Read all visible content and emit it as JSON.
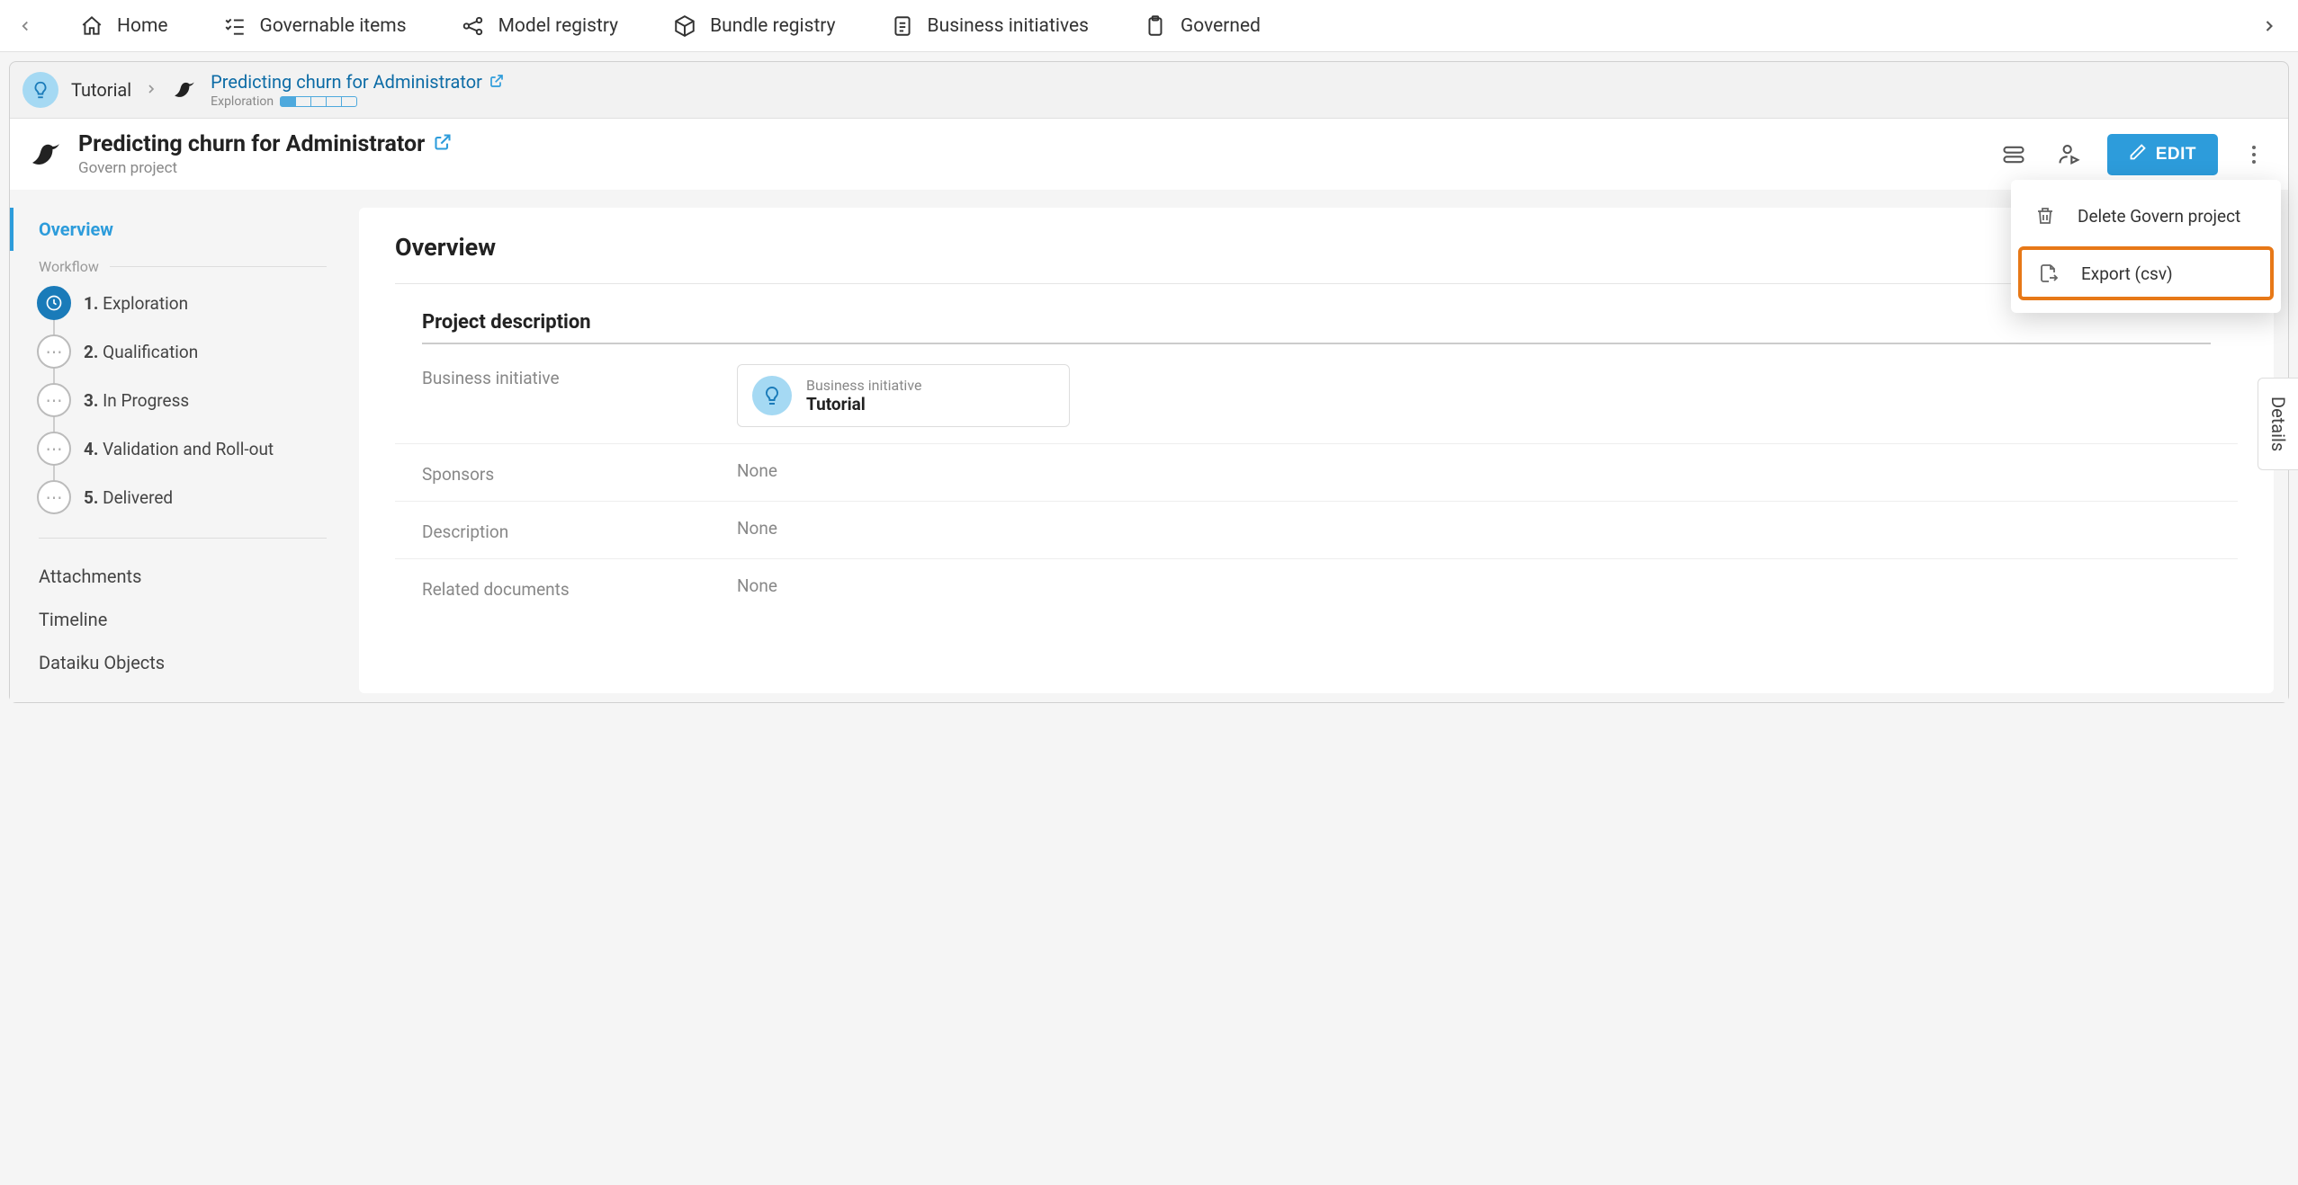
{
  "topnav": {
    "items": [
      {
        "label": "Home"
      },
      {
        "label": "Governable items"
      },
      {
        "label": "Model registry"
      },
      {
        "label": "Bundle registry"
      },
      {
        "label": "Business initiatives"
      },
      {
        "label": "Governed"
      }
    ]
  },
  "breadcrumb": {
    "tutorial": "Tutorial",
    "project_title": "Predicting churn for Administrator",
    "stage": "Exploration"
  },
  "titlebar": {
    "title": "Predicting churn for Administrator",
    "subtitle": "Govern project",
    "edit_label": "EDIT"
  },
  "dropdown": {
    "delete": "Delete Govern project",
    "export": "Export (csv)"
  },
  "sidebar": {
    "overview": "Overview",
    "workflow_label": "Workflow",
    "steps": [
      {
        "num": "1.",
        "label": "Exploration"
      },
      {
        "num": "2.",
        "label": "Qualification"
      },
      {
        "num": "3.",
        "label": "In Progress"
      },
      {
        "num": "4.",
        "label": "Validation and Roll-out"
      },
      {
        "num": "5.",
        "label": "Delivered"
      }
    ],
    "attachments": "Attachments",
    "timeline": "Timeline",
    "dataiku_objects": "Dataiku Objects"
  },
  "main": {
    "heading": "Overview",
    "section": "Project description",
    "fields": {
      "business_initiative": {
        "label": "Business initiative",
        "card_sub": "Business initiative",
        "card_title": "Tutorial"
      },
      "sponsors": {
        "label": "Sponsors",
        "value": "None"
      },
      "description": {
        "label": "Description",
        "value": "None"
      },
      "related_documents": {
        "label": "Related documents",
        "value": "None"
      }
    }
  },
  "details_tab": "Details"
}
